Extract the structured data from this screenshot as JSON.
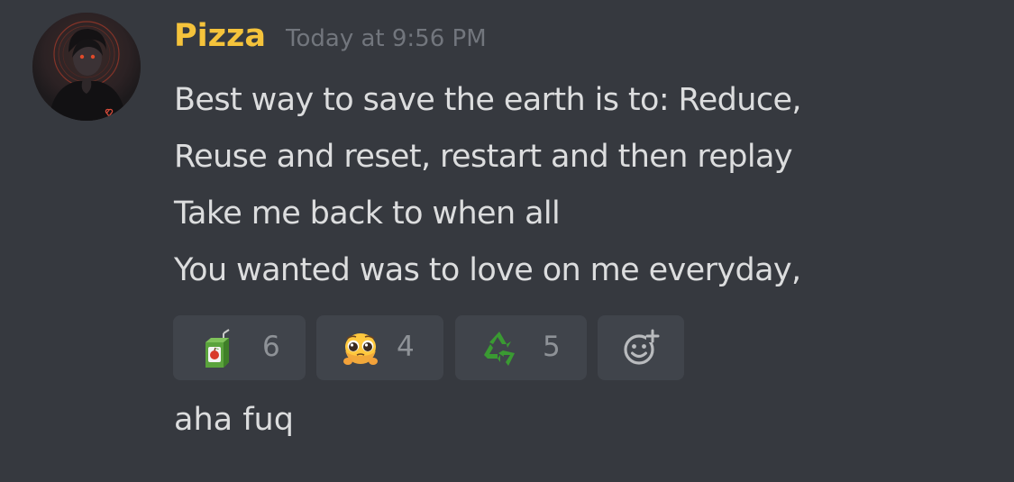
{
  "message": {
    "author": "Pizza",
    "author_color": "#f5c33b",
    "timestamp": "Today at 9:56 PM",
    "lines": [
      "Best way to save the earth is to: Reduce,",
      "Reuse and reset, restart and then replay",
      "Take me back to when all",
      "You wanted was to love on me everyday,"
    ],
    "reactions": [
      {
        "emoji": "juice-box-icon",
        "count": "6"
      },
      {
        "emoji": "pleading-face-icon",
        "count": "4"
      },
      {
        "emoji": "recycle-icon",
        "count": "5"
      }
    ],
    "add_reaction_icon": "add-reaction-icon",
    "followup": "aha fuq"
  },
  "colors": {
    "background": "#36393f",
    "reaction_bg": "#40444b",
    "text": "#dcddde",
    "muted": "#72767d",
    "recycle_green": "#3a9a32"
  }
}
